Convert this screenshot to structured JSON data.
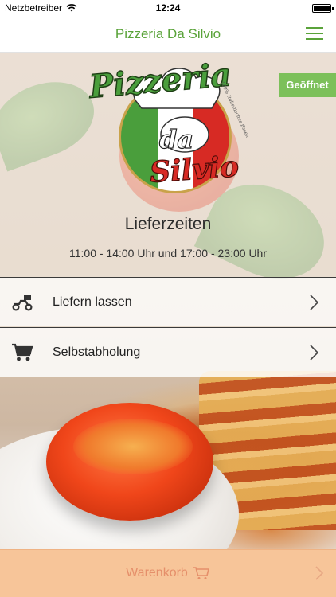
{
  "status_bar": {
    "carrier": "Netzbetreiber",
    "time": "12:24"
  },
  "header": {
    "title": "Pizzeria Da Silvio",
    "menu_icon": "hamburger-menu-icon"
  },
  "badge": {
    "label": "Geöffnet",
    "color": "#7cc05a"
  },
  "logo": {
    "line1": "Pizzeria",
    "line2": "da",
    "line3": "Silvio",
    "tagline": "100% Italienisches Essen"
  },
  "delivery_times": {
    "title": "Lieferzeiten",
    "hours": "11:00 - 14:00 Uhr und 17:00 - 23:00 Uhr"
  },
  "options": [
    {
      "label": "Liefern lassen",
      "icon": "delivery-scooter-icon"
    },
    {
      "label": "Selbstabholung",
      "icon": "shopping-cart-icon"
    }
  ],
  "cart": {
    "label": "Warenkorb",
    "icon": "cart-icon"
  },
  "colors": {
    "accent_green": "#5aa33a",
    "cart_bg": "#f7c599",
    "cart_text": "#e58f6a"
  }
}
